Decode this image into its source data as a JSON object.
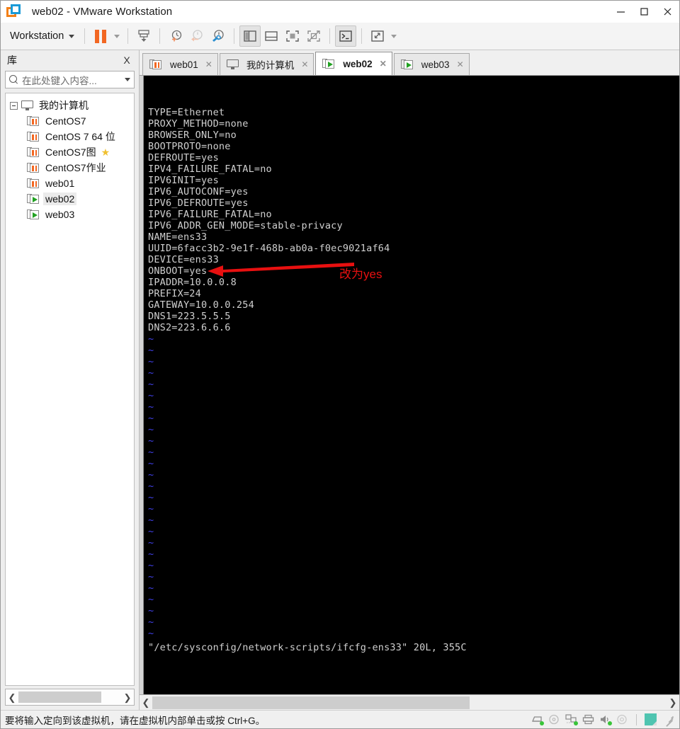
{
  "window": {
    "title": "web02 - VMware Workstation",
    "logo_colors": {
      "orange": "#f28018",
      "blue": "#1a9ad7"
    },
    "controls": {
      "minimize": "minimize-button",
      "maximize": "maximize-button",
      "close": "close-button"
    }
  },
  "toolbar": {
    "menu_label": "Workstation",
    "buttons": [
      "pause-vm-button",
      "pause-dropdown",
      "snapshot-manager-button",
      "take-snapshot-button",
      "revert-snapshot-button",
      "manage-snapshots-button",
      "show-library-button",
      "show-thumbnails-button",
      "full-screen-button",
      "unity-mode-button",
      "console-view-button",
      "stretch-view-button",
      "view-dropdown"
    ]
  },
  "sidebar": {
    "title": "库",
    "close_label": "X",
    "search": {
      "placeholder": "在此处键入内容...",
      "value": ""
    },
    "tree": {
      "root": {
        "label": "我的计算机",
        "icon": "monitor-icon",
        "expanded": true
      },
      "items": [
        {
          "label": "CentOS7",
          "state": "paused",
          "favorite": false,
          "selected": false
        },
        {
          "label": "CentOS 7 64 位",
          "state": "paused",
          "favorite": false,
          "selected": false
        },
        {
          "label": "CentOS7图",
          "state": "paused",
          "favorite": true,
          "selected": false
        },
        {
          "label": "CentOS7作业",
          "state": "paused",
          "favorite": false,
          "selected": false
        },
        {
          "label": "web01",
          "state": "paused",
          "favorite": false,
          "selected": false
        },
        {
          "label": "web02",
          "state": "running",
          "favorite": false,
          "selected": true
        },
        {
          "label": "web03",
          "state": "running",
          "favorite": false,
          "selected": false
        }
      ]
    },
    "scrollbar": {
      "left_arrow": "❮",
      "right_arrow": "❯"
    }
  },
  "tabs": [
    {
      "label": "web01",
      "icon": "vm-paused-icon",
      "active": false,
      "close": "✕"
    },
    {
      "label": "我的计算机",
      "icon": "monitor-icon",
      "active": false,
      "close": "✕"
    },
    {
      "label": "web02",
      "icon": "vm-running-icon",
      "active": true,
      "close": "✕"
    },
    {
      "label": "web03",
      "icon": "vm-running-icon",
      "active": false,
      "close": "✕"
    }
  ],
  "terminal": {
    "config_lines": [
      "TYPE=Ethernet",
      "PROXY_METHOD=none",
      "BROWSER_ONLY=no",
      "BOOTPROTO=none",
      "DEFROUTE=yes",
      "IPV4_FAILURE_FATAL=no",
      "IPV6INIT=yes",
      "IPV6_AUTOCONF=yes",
      "IPV6_DEFROUTE=yes",
      "IPV6_FAILURE_FATAL=no",
      "IPV6_ADDR_GEN_MODE=stable-privacy",
      "NAME=ens33",
      "UUID=6facc3b2-9e1f-468b-ab0a-f0ec9021af64",
      "DEVICE=ens33",
      "ONBOOT=yes",
      "IPADDR=10.0.0.8",
      "PREFIX=24",
      "GATEWAY=10.0.0.254",
      "DNS1=223.5.5.5",
      "DNS2=223.6.6.6"
    ],
    "empty_marker": "~",
    "empty_line_count": 27,
    "status_line": "\"/etc/sysconfig/network-scripts/ifcfg-ens33\" 20L, 355C",
    "annotation": {
      "text": "改为yes",
      "color": "#e81010",
      "arrow": "left-arrow",
      "target_line": "ONBOOT=yes"
    },
    "scrollbar": {
      "left_arrow": "❮",
      "right_arrow": "❯"
    }
  },
  "statusbar": {
    "message": "要将输入定向到该虚拟机，请在虚拟机内部单击或按 Ctrl+G。",
    "devices": [
      "hard-disk-icon",
      "cd-dvd-icon",
      "network-adapter-icon",
      "printer-icon",
      "sound-card-icon",
      "usb-icon"
    ],
    "note_icon": "note-icon",
    "grip": "resize-grip"
  }
}
